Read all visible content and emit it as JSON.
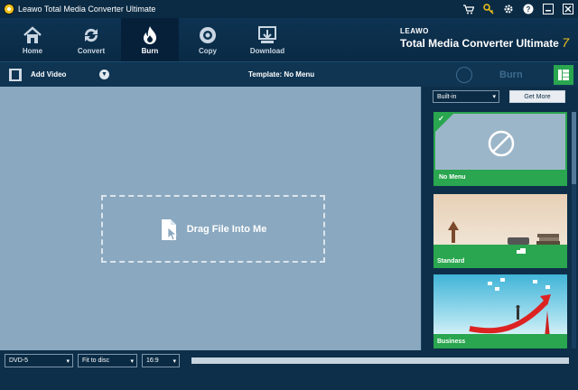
{
  "window": {
    "title": "Leawo Total Media Converter Ultimate"
  },
  "titlebar_icons": [
    "cart-icon",
    "key-icon",
    "gear-icon",
    "help-icon",
    "minimize-icon",
    "close-icon"
  ],
  "nav": {
    "items": [
      {
        "label": "Home",
        "icon": "home-icon"
      },
      {
        "label": "Convert",
        "icon": "convert-icon"
      },
      {
        "label": "Burn",
        "icon": "flame-icon",
        "active": true
      },
      {
        "label": "Copy",
        "icon": "disc-icon"
      },
      {
        "label": "Download",
        "icon": "download-icon"
      }
    ]
  },
  "brand": {
    "logo": "LEAWO",
    "product": "Total Media Converter Ultimate",
    "version": "7"
  },
  "toolbar": {
    "add_video": "Add Video",
    "template": "Template: No Menu",
    "burn": "Burn"
  },
  "dropzone": {
    "text": "Drag File Into Me"
  },
  "sidepanel": {
    "source_select": "Built-in",
    "get_more": "Get More",
    "templates": [
      {
        "name": "No Menu",
        "selected": true
      },
      {
        "name": "Standard"
      },
      {
        "name": "Business"
      }
    ]
  },
  "bottombar": {
    "disc_type": "DVD-5",
    "fit": "Fit to disc",
    "aspect": "16:9"
  },
  "colors": {
    "accent_green": "#29a64f",
    "nav_bg": "#0d3352",
    "main_bg": "#8aa8bf"
  }
}
